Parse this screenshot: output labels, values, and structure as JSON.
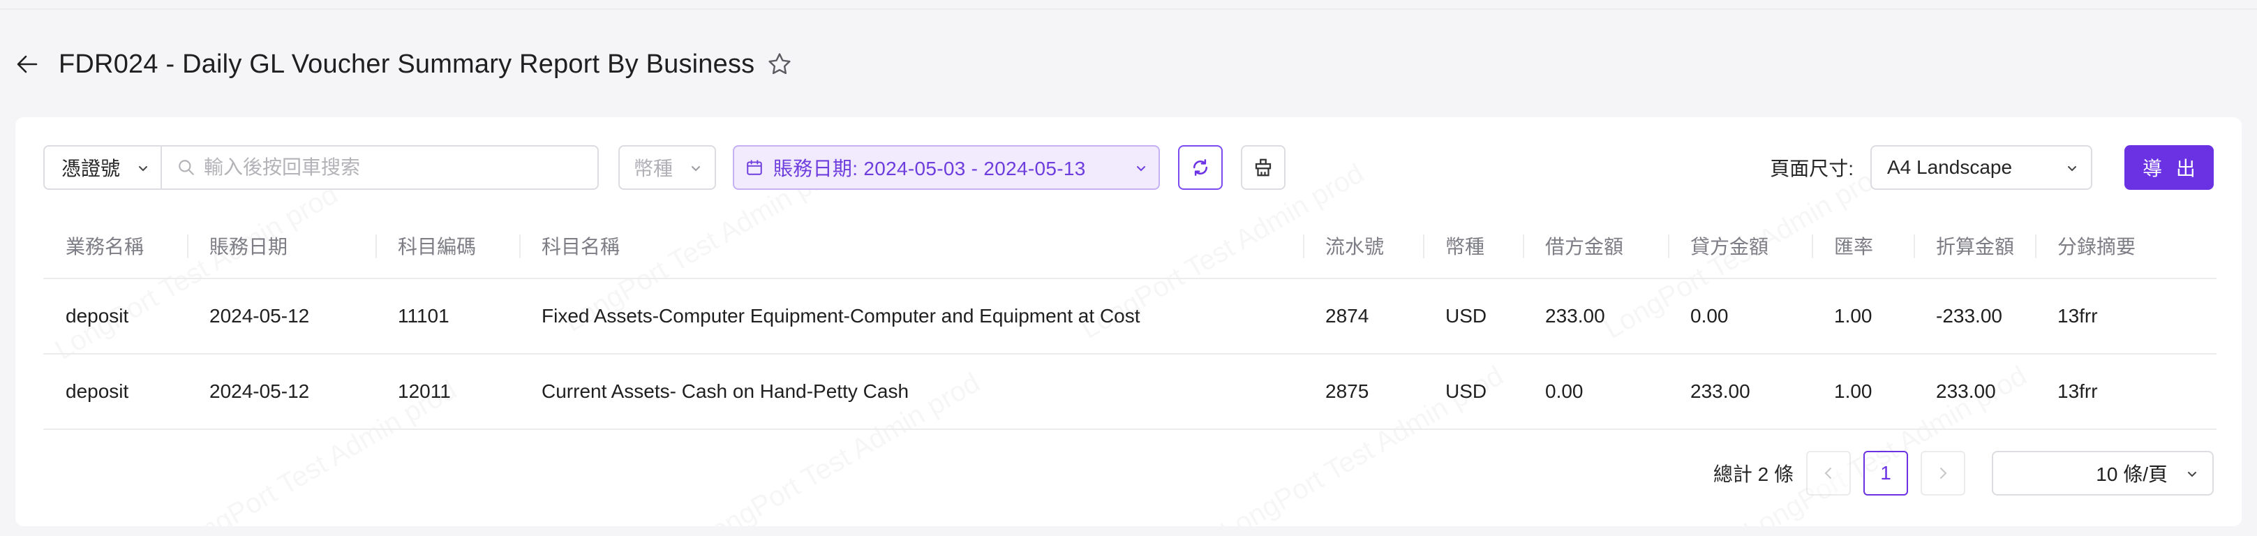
{
  "header": {
    "title": "FDR024 - Daily GL Voucher Summary Report By Business",
    "back_icon": "arrow-left-icon",
    "favorite_icon": "star-outline-icon"
  },
  "filters": {
    "voucher_type": "憑證號",
    "search_placeholder": "輸入後按回車搜索",
    "currency_placeholder": "幣種",
    "date_range_label": "賬務日期: 2024-05-03 - 2024-05-13",
    "refresh_icon": "refresh-icon",
    "clear_icon": "clear-filter-icon",
    "page_size_label": "頁面尺寸:",
    "page_size_value": "A4 Landscape",
    "export_label": "導 出"
  },
  "table": {
    "columns": [
      "業務名稱",
      "賬務日期",
      "科目編碼",
      "科目名稱",
      "流水號",
      "幣種",
      "借方金額",
      "貸方金額",
      "匯率",
      "折算金額",
      "分錄摘要"
    ],
    "rows": [
      [
        "deposit",
        "2024-05-12",
        "11101",
        "Fixed Assets-Computer Equipment-Computer and Equipment at Cost",
        "2874",
        "USD",
        "233.00",
        "0.00",
        "1.00",
        "-233.00",
        "13frr"
      ],
      [
        "deposit",
        "2024-05-12",
        "12011",
        "Current Assets- Cash on Hand-Petty Cash",
        "2875",
        "USD",
        "0.00",
        "233.00",
        "1.00",
        "233.00",
        "13frr"
      ]
    ]
  },
  "pagination": {
    "total": "總計 2 條",
    "current_page": "1",
    "per_page": "10 條/頁"
  },
  "watermark": "LongPort Test Admin prod",
  "colors": {
    "accent": "#6b32e4",
    "date_bg": "#f1ebfd",
    "border": "#dcdce1",
    "muted_text": "#7d7d85"
  }
}
